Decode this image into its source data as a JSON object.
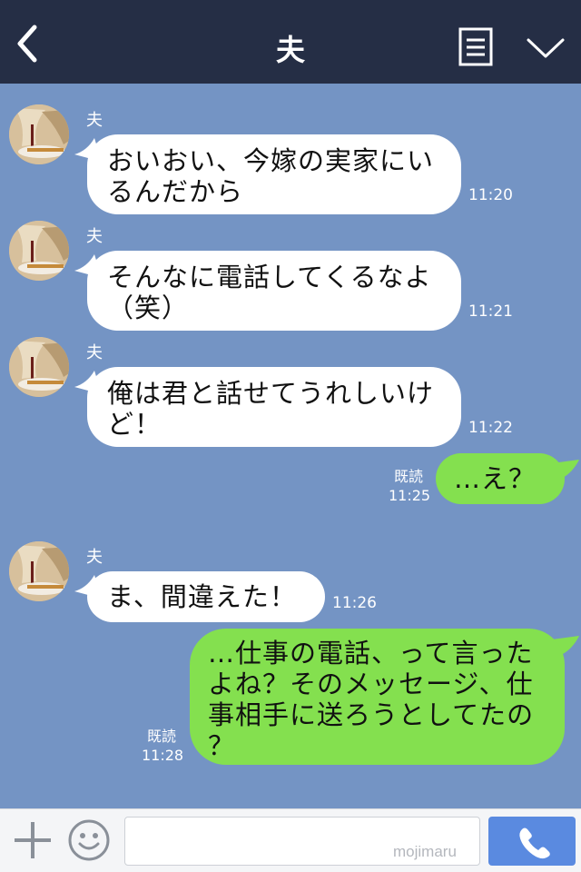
{
  "header": {
    "title": "夫",
    "back_icon": "chevron-left-icon",
    "menu_icon": "notes-icon",
    "more_icon": "chevron-down-icon"
  },
  "messages": [
    {
      "sender": "夫",
      "text": [
        "おいおい、今嫁の実家にい",
        "るんだから"
      ],
      "time": "11:20"
    },
    {
      "sender": "夫",
      "text": [
        "そんなに電話してくるなよ",
        "（笑）"
      ],
      "time": "11:21"
    },
    {
      "sender": "夫",
      "text": [
        "俺は君と話せてうれしいけ",
        "ど！"
      ],
      "time": "11:22"
    },
    {
      "read": "既読",
      "text": [
        "…え？"
      ],
      "time": "11:25"
    },
    {
      "sender": "夫",
      "text": [
        "ま、間違えた！"
      ],
      "time": "11:26"
    },
    {
      "read": "既読",
      "text": [
        "…仕事の電話、って言った",
        "よね？そのメッセージ、仕",
        "事相手に送ろうとしてたの",
        "？"
      ],
      "time": "11:28"
    }
  ],
  "inputbar": {
    "placeholder": "",
    "watermark": "mojimaru",
    "plus_icon": "plus-icon",
    "emoji_icon": "smiley-icon",
    "call_icon": "phone-icon"
  },
  "colors": {
    "header_bg": "#252e45",
    "chat_bg": "#7494c4",
    "incoming_bubble": "#ffffff",
    "outgoing_bubble": "#84e04f",
    "call_button": "#5a8ae0"
  }
}
